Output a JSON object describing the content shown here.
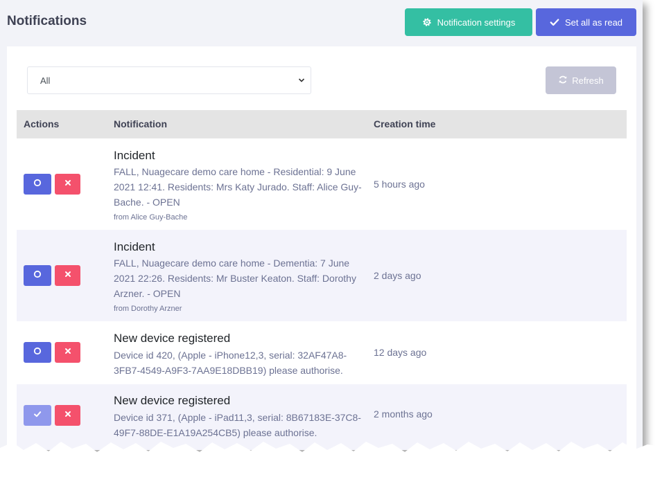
{
  "header": {
    "title": "Notifications",
    "settings_label": "Notification settings",
    "read_all_label": "Set all as read"
  },
  "filter": {
    "selected": "All"
  },
  "toolbar": {
    "refresh_label": "Refresh"
  },
  "table": {
    "columns": [
      "Actions",
      "Notification",
      "Creation time"
    ],
    "rows": [
      {
        "title": "Incident",
        "body": "FALL, Nuagecare demo care home - Residential: 9 June 2021 12:41. Residents: Mrs Katy Jurado. Staff: Alice Guy-Bache. - OPEN",
        "from": "from Alice Guy-Bache",
        "time": "5 hours ago",
        "read": false
      },
      {
        "title": "Incident",
        "body": "FALL, Nuagecare demo care home - Dementia: 7 June 2021 22:26. Residents: Mr Buster Keaton. Staff: Dorothy Arzner. - OPEN",
        "from": "from Dorothy Arzner",
        "time": "2 days ago",
        "read": false
      },
      {
        "title": "New device registered",
        "body": "Device id 420, (Apple - iPhone12,3, serial: 32AF47A8-3FB7-4549-A9F3-7AA9E18DBB19) please authorise.",
        "from": "",
        "time": "12 days ago",
        "read": false
      },
      {
        "title": "New device registered",
        "body": "Device id 371, (Apple - iPad11,3, serial: 8B67183E-37C8-49F7-88DE-E1A19A254CB5) please authorise.",
        "from": "",
        "time": "2 months ago",
        "read": true
      }
    ]
  },
  "icons": {
    "settings": "gear-icon",
    "read_all": "check-icon",
    "refresh": "refresh-icon",
    "mark_read": "circle-icon",
    "marked_read": "check-icon",
    "delete": "close-icon"
  },
  "colors": {
    "success": "#34bfa3",
    "primary": "#5867dd",
    "primary_muted": "#8f98ec",
    "danger": "#f4516c",
    "disabled": "#c4c5d6"
  }
}
